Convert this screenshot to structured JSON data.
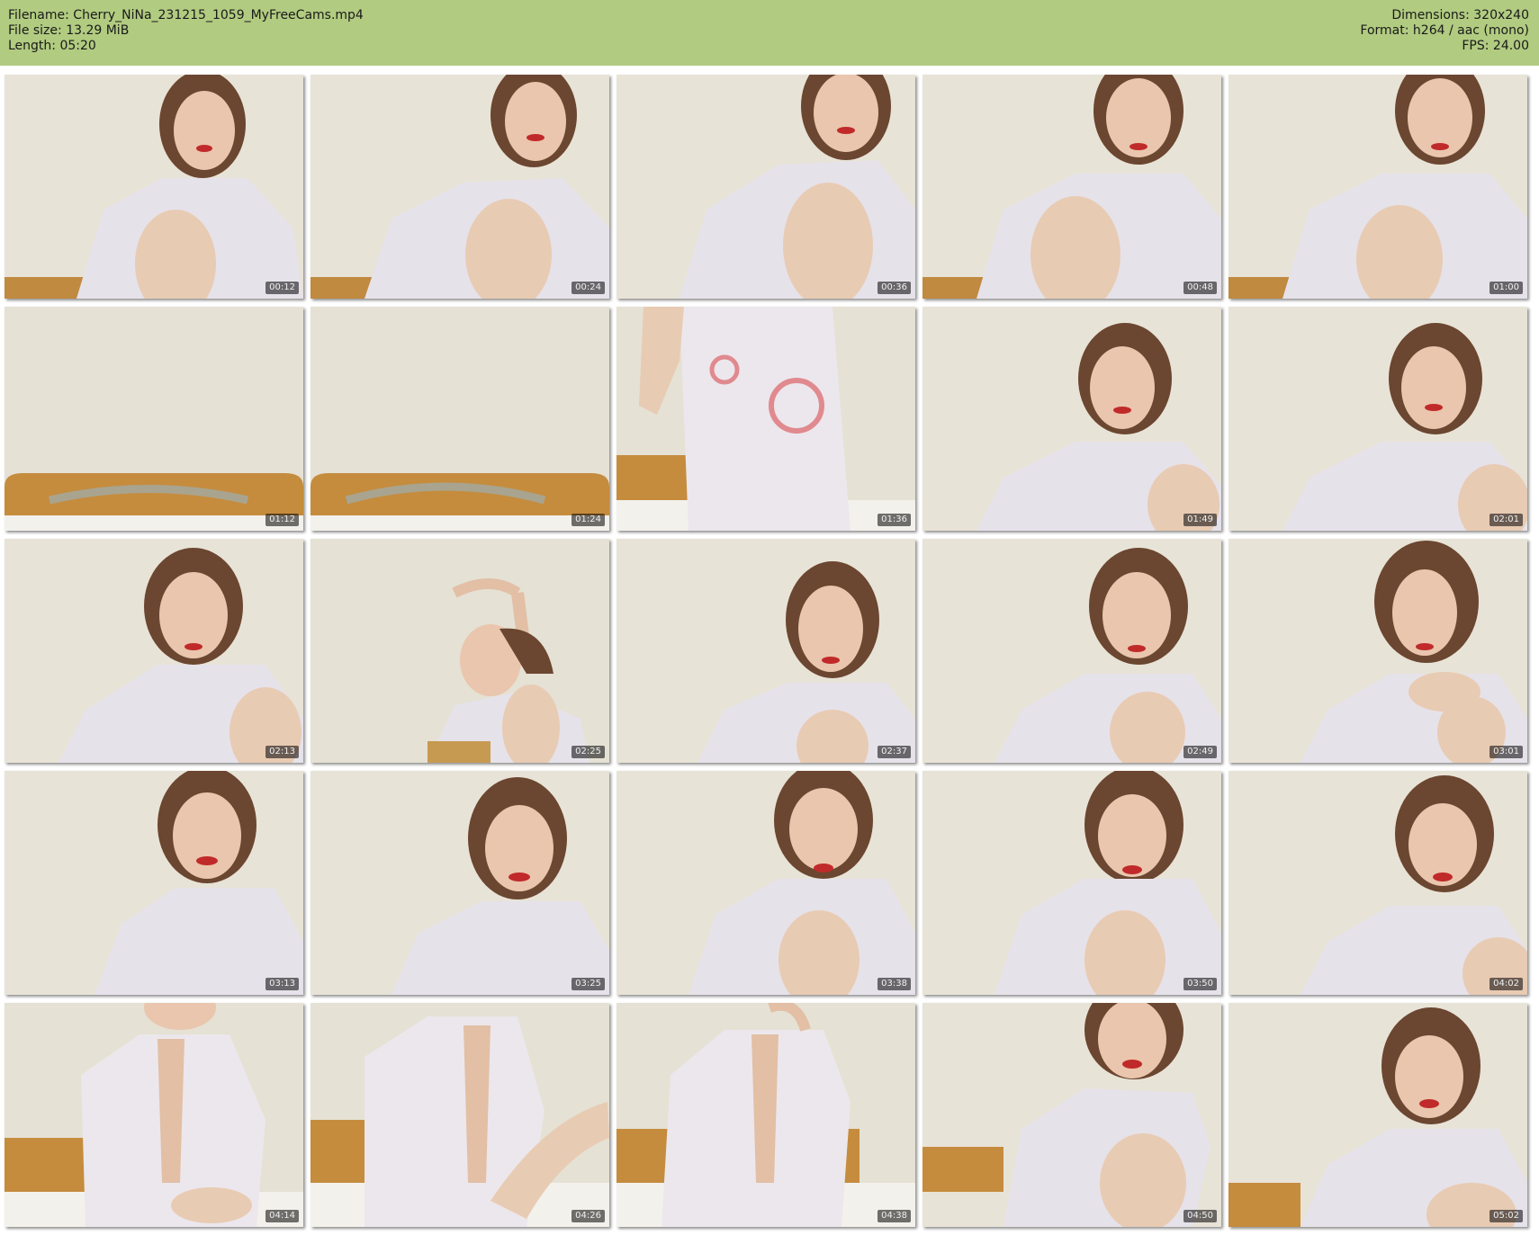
{
  "header": {
    "filename": "Filename: Cherry_NiNa_231215_1059_MyFreeCams.mp4",
    "filesize": "File size: 13.29 MiB",
    "length": "Length: 05:20",
    "dimensions": "Dimensions: 320x240",
    "format": "Format: h264 / aac (mono)",
    "fps": "FPS: 24.00",
    "bg_color": "#b1cb80"
  },
  "thumbnails": [
    {
      "time": "00:12"
    },
    {
      "time": "00:24"
    },
    {
      "time": "00:36"
    },
    {
      "time": "00:48"
    },
    {
      "time": "01:00"
    },
    {
      "time": "01:12"
    },
    {
      "time": "01:24"
    },
    {
      "time": "01:36"
    },
    {
      "time": "01:49"
    },
    {
      "time": "02:01"
    },
    {
      "time": "02:13"
    },
    {
      "time": "02:25"
    },
    {
      "time": "02:37"
    },
    {
      "time": "02:49"
    },
    {
      "time": "03:01"
    },
    {
      "time": "03:13"
    },
    {
      "time": "03:25"
    },
    {
      "time": "03:38"
    },
    {
      "time": "03:50"
    },
    {
      "time": "04:02"
    },
    {
      "time": "04:14"
    },
    {
      "time": "04:26"
    },
    {
      "time": "04:38"
    },
    {
      "time": "04:50"
    },
    {
      "time": "05:02"
    }
  ]
}
